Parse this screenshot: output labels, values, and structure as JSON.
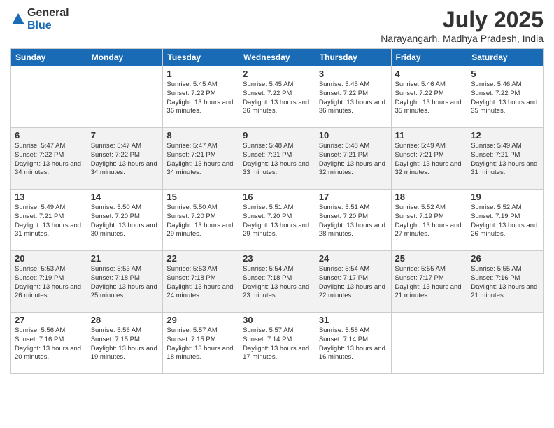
{
  "logo": {
    "general": "General",
    "blue": "Blue"
  },
  "header": {
    "title": "July 2025",
    "subtitle": "Narayangarh, Madhya Pradesh, India"
  },
  "weekdays": [
    "Sunday",
    "Monday",
    "Tuesday",
    "Wednesday",
    "Thursday",
    "Friday",
    "Saturday"
  ],
  "weeks": [
    [
      {
        "day": "",
        "sunrise": "",
        "sunset": "",
        "daylight": ""
      },
      {
        "day": "",
        "sunrise": "",
        "sunset": "",
        "daylight": ""
      },
      {
        "day": "1",
        "sunrise": "Sunrise: 5:45 AM",
        "sunset": "Sunset: 7:22 PM",
        "daylight": "Daylight: 13 hours and 36 minutes."
      },
      {
        "day": "2",
        "sunrise": "Sunrise: 5:45 AM",
        "sunset": "Sunset: 7:22 PM",
        "daylight": "Daylight: 13 hours and 36 minutes."
      },
      {
        "day": "3",
        "sunrise": "Sunrise: 5:45 AM",
        "sunset": "Sunset: 7:22 PM",
        "daylight": "Daylight: 13 hours and 36 minutes."
      },
      {
        "day": "4",
        "sunrise": "Sunrise: 5:46 AM",
        "sunset": "Sunset: 7:22 PM",
        "daylight": "Daylight: 13 hours and 35 minutes."
      },
      {
        "day": "5",
        "sunrise": "Sunrise: 5:46 AM",
        "sunset": "Sunset: 7:22 PM",
        "daylight": "Daylight: 13 hours and 35 minutes."
      }
    ],
    [
      {
        "day": "6",
        "sunrise": "Sunrise: 5:47 AM",
        "sunset": "Sunset: 7:22 PM",
        "daylight": "Daylight: 13 hours and 34 minutes."
      },
      {
        "day": "7",
        "sunrise": "Sunrise: 5:47 AM",
        "sunset": "Sunset: 7:22 PM",
        "daylight": "Daylight: 13 hours and 34 minutes."
      },
      {
        "day": "8",
        "sunrise": "Sunrise: 5:47 AM",
        "sunset": "Sunset: 7:21 PM",
        "daylight": "Daylight: 13 hours and 34 minutes."
      },
      {
        "day": "9",
        "sunrise": "Sunrise: 5:48 AM",
        "sunset": "Sunset: 7:21 PM",
        "daylight": "Daylight: 13 hours and 33 minutes."
      },
      {
        "day": "10",
        "sunrise": "Sunrise: 5:48 AM",
        "sunset": "Sunset: 7:21 PM",
        "daylight": "Daylight: 13 hours and 32 minutes."
      },
      {
        "day": "11",
        "sunrise": "Sunrise: 5:49 AM",
        "sunset": "Sunset: 7:21 PM",
        "daylight": "Daylight: 13 hours and 32 minutes."
      },
      {
        "day": "12",
        "sunrise": "Sunrise: 5:49 AM",
        "sunset": "Sunset: 7:21 PM",
        "daylight": "Daylight: 13 hours and 31 minutes."
      }
    ],
    [
      {
        "day": "13",
        "sunrise": "Sunrise: 5:49 AM",
        "sunset": "Sunset: 7:21 PM",
        "daylight": "Daylight: 13 hours and 31 minutes."
      },
      {
        "day": "14",
        "sunrise": "Sunrise: 5:50 AM",
        "sunset": "Sunset: 7:20 PM",
        "daylight": "Daylight: 13 hours and 30 minutes."
      },
      {
        "day": "15",
        "sunrise": "Sunrise: 5:50 AM",
        "sunset": "Sunset: 7:20 PM",
        "daylight": "Daylight: 13 hours and 29 minutes."
      },
      {
        "day": "16",
        "sunrise": "Sunrise: 5:51 AM",
        "sunset": "Sunset: 7:20 PM",
        "daylight": "Daylight: 13 hours and 29 minutes."
      },
      {
        "day": "17",
        "sunrise": "Sunrise: 5:51 AM",
        "sunset": "Sunset: 7:20 PM",
        "daylight": "Daylight: 13 hours and 28 minutes."
      },
      {
        "day": "18",
        "sunrise": "Sunrise: 5:52 AM",
        "sunset": "Sunset: 7:19 PM",
        "daylight": "Daylight: 13 hours and 27 minutes."
      },
      {
        "day": "19",
        "sunrise": "Sunrise: 5:52 AM",
        "sunset": "Sunset: 7:19 PM",
        "daylight": "Daylight: 13 hours and 26 minutes."
      }
    ],
    [
      {
        "day": "20",
        "sunrise": "Sunrise: 5:53 AM",
        "sunset": "Sunset: 7:19 PM",
        "daylight": "Daylight: 13 hours and 26 minutes."
      },
      {
        "day": "21",
        "sunrise": "Sunrise: 5:53 AM",
        "sunset": "Sunset: 7:18 PM",
        "daylight": "Daylight: 13 hours and 25 minutes."
      },
      {
        "day": "22",
        "sunrise": "Sunrise: 5:53 AM",
        "sunset": "Sunset: 7:18 PM",
        "daylight": "Daylight: 13 hours and 24 minutes."
      },
      {
        "day": "23",
        "sunrise": "Sunrise: 5:54 AM",
        "sunset": "Sunset: 7:18 PM",
        "daylight": "Daylight: 13 hours and 23 minutes."
      },
      {
        "day": "24",
        "sunrise": "Sunrise: 5:54 AM",
        "sunset": "Sunset: 7:17 PM",
        "daylight": "Daylight: 13 hours and 22 minutes."
      },
      {
        "day": "25",
        "sunrise": "Sunrise: 5:55 AM",
        "sunset": "Sunset: 7:17 PM",
        "daylight": "Daylight: 13 hours and 21 minutes."
      },
      {
        "day": "26",
        "sunrise": "Sunrise: 5:55 AM",
        "sunset": "Sunset: 7:16 PM",
        "daylight": "Daylight: 13 hours and 21 minutes."
      }
    ],
    [
      {
        "day": "27",
        "sunrise": "Sunrise: 5:56 AM",
        "sunset": "Sunset: 7:16 PM",
        "daylight": "Daylight: 13 hours and 20 minutes."
      },
      {
        "day": "28",
        "sunrise": "Sunrise: 5:56 AM",
        "sunset": "Sunset: 7:15 PM",
        "daylight": "Daylight: 13 hours and 19 minutes."
      },
      {
        "day": "29",
        "sunrise": "Sunrise: 5:57 AM",
        "sunset": "Sunset: 7:15 PM",
        "daylight": "Daylight: 13 hours and 18 minutes."
      },
      {
        "day": "30",
        "sunrise": "Sunrise: 5:57 AM",
        "sunset": "Sunset: 7:14 PM",
        "daylight": "Daylight: 13 hours and 17 minutes."
      },
      {
        "day": "31",
        "sunrise": "Sunrise: 5:58 AM",
        "sunset": "Sunset: 7:14 PM",
        "daylight": "Daylight: 13 hours and 16 minutes."
      },
      {
        "day": "",
        "sunrise": "",
        "sunset": "",
        "daylight": ""
      },
      {
        "day": "",
        "sunrise": "",
        "sunset": "",
        "daylight": ""
      }
    ]
  ]
}
